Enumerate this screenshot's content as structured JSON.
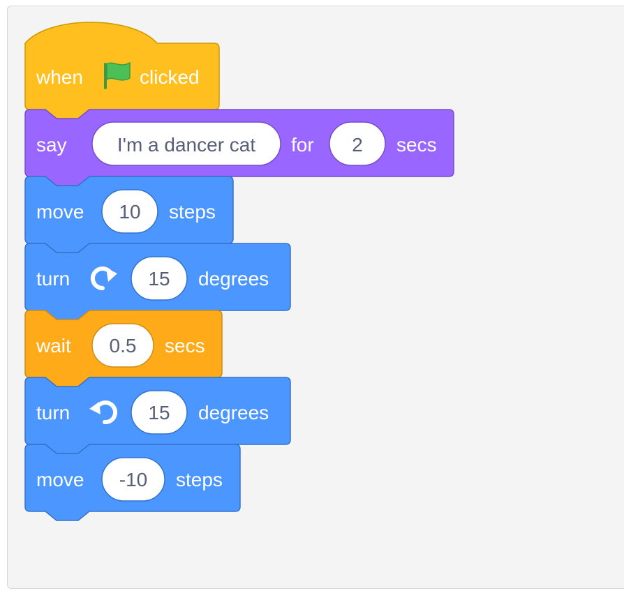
{
  "colors": {
    "events": "#ffbf1f",
    "events_stroke": "#cc9900",
    "looks": "#9966ff",
    "looks_stroke": "#774dcb",
    "motion": "#4c97ff",
    "motion_stroke": "#3373cc",
    "control": "#ffab19",
    "control_stroke": "#cf8b17",
    "flag": "#4cbf56",
    "input_text": "#575e75"
  },
  "script": {
    "hat": {
      "when": "when",
      "flag_icon": "green-flag-icon",
      "clicked": "clicked"
    },
    "say": {
      "label": "say",
      "message": "I'm a dancer cat",
      "for": "for",
      "duration": "2",
      "secs": "secs"
    },
    "move1": {
      "label": "move",
      "steps_value": "10",
      "steps": "steps"
    },
    "turn_right": {
      "label": "turn",
      "icon": "rotate-right-icon",
      "value": "15",
      "degrees": "degrees"
    },
    "wait": {
      "label": "wait",
      "value": "0.5",
      "secs": "secs"
    },
    "turn_left": {
      "label": "turn",
      "icon": "rotate-left-icon",
      "value": "15",
      "degrees": "degrees"
    },
    "move2": {
      "label": "move",
      "steps_value": "-10",
      "steps": "steps"
    }
  }
}
